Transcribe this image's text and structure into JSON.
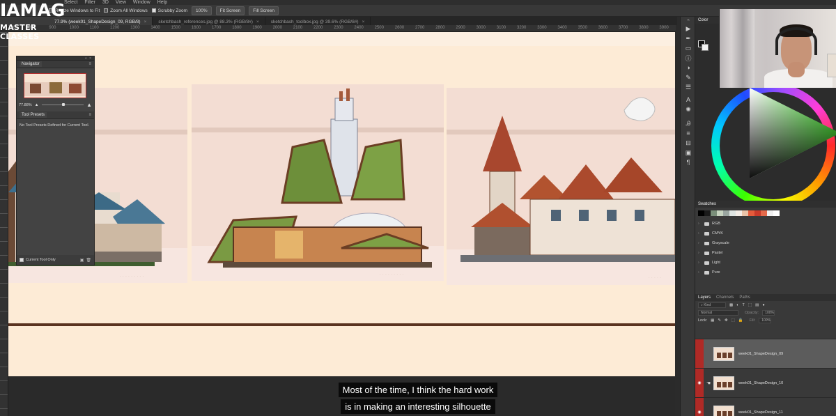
{
  "logo": {
    "line1": "IAMAG",
    "line2": "MASTER CLASSES"
  },
  "menu": [
    "Select",
    "Filter",
    "3D",
    "View",
    "Window",
    "Help"
  ],
  "options_bar": {
    "resize_windows": "Resize Windows to Fit",
    "zoom_all": "Zoom All Windows",
    "scrubby_zoom": "Scrubby Zoom",
    "zoom_value": "100%",
    "fit_screen": "Fit Screen",
    "fill_screen": "Fill Screen"
  },
  "tabs": [
    {
      "label": "77.9% (week01_ShapeDesign_09, RGB/8)",
      "active": true
    },
    {
      "label": "sketchbash_references.jpg @ 88.3% (RGB/8#)",
      "active": false
    },
    {
      "label": "sketchbash_toolbox.jpg @ 39.6% (RGB/8#)",
      "active": false
    }
  ],
  "ruler_labels": [
    "700",
    "800",
    "900",
    "1000",
    "1100",
    "1200",
    "1300",
    "1400",
    "1500",
    "1600",
    "1700",
    "1800",
    "1900",
    "2000",
    "2100",
    "2200",
    "2300",
    "2400",
    "2500",
    "2600",
    "2700",
    "2800",
    "2900",
    "3000",
    "3100",
    "3200",
    "3300",
    "3400",
    "3500",
    "3600",
    "3700",
    "3800",
    "3900",
    "4000"
  ],
  "navigator": {
    "title": "Navigator",
    "zoom": "77.88%"
  },
  "tool_presets": {
    "title": "Tool Presets",
    "empty_message": "No Tool Presets Defined for Current Tool.",
    "current_tool_only": "Current Tool Only"
  },
  "color_panel": {
    "title": "Color"
  },
  "swatches_panel": {
    "title": "Swatches",
    "colors": [
      "#000000",
      "#1a1a1a",
      "#7a8f7a",
      "#c6d3bf",
      "#9aa6a0",
      "#dfe4e2",
      "#f3ece6",
      "#e9c3a8",
      "#e45b3b",
      "#c93a2a",
      "#e46a4b",
      "#f0f0f0",
      "#ffffff"
    ],
    "folders": [
      "RGB",
      "CMYK",
      "Grayscale",
      "Pastel",
      "Light",
      "Pure"
    ]
  },
  "layers_panel": {
    "tabs": [
      "Layers",
      "Channels",
      "Paths"
    ],
    "kind": "Kind",
    "blend_mode": "Normal",
    "opacity_label": "Opacity:",
    "opacity_value": "100%",
    "lock_label": "Lock:",
    "fill_label": "Fill:",
    "fill_value": "100%",
    "layers": [
      {
        "name": "week01_ShapeDesign_09",
        "selected": true
      },
      {
        "name": "week01_ShapeDesign_10",
        "selected": false
      },
      {
        "name": "week01_ShapeDesign_11",
        "selected": false
      }
    ]
  },
  "captions": [
    "Most of the time, I think the hard work",
    "is in making an interesting silhouette"
  ],
  "icons": {
    "tools": [
      "move-icon",
      "pen-icon",
      "ruler-icon",
      "info-icon",
      "adjust-icon",
      "brush-icon",
      "sliders-icon",
      "type-icon",
      "settings-icon",
      "character-icon",
      "levels-icon",
      "stamp-icon",
      "layers-icon",
      "paragraph-icon"
    ]
  }
}
